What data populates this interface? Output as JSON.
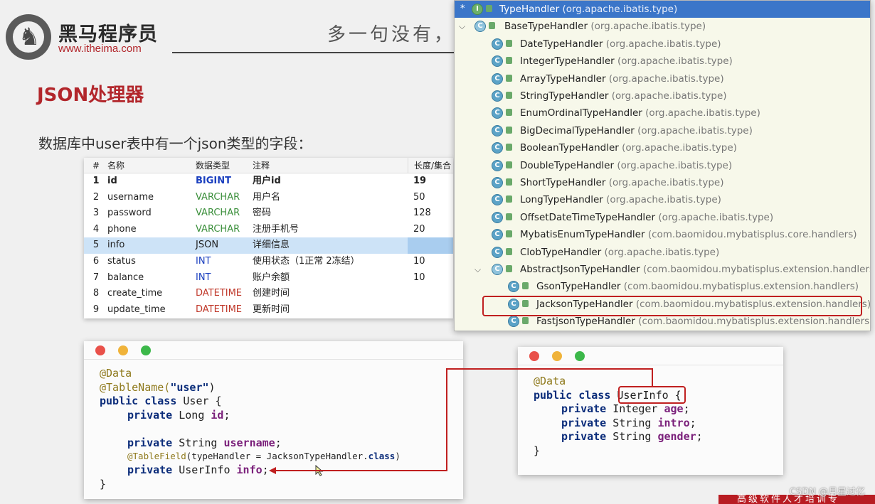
{
  "brand": {
    "name": "黑马程序员",
    "url": "www.itheima.com",
    "slogan": "多一句没有，少"
  },
  "slide": {
    "title": "JSON处理器",
    "subtitle": "数据库中user表中有一个json类型的字段："
  },
  "db_table": {
    "headers": [
      "#",
      "名称",
      "数据类型",
      "注释",
      "长度/集合"
    ],
    "rows": [
      {
        "num": "1",
        "name": "id",
        "type": "BIGINT",
        "note": "用户id",
        "len": "19"
      },
      {
        "num": "2",
        "name": "username",
        "type": "VARCHAR",
        "note": "用户名",
        "len": "50"
      },
      {
        "num": "3",
        "name": "password",
        "type": "VARCHAR",
        "note": "密码",
        "len": "128"
      },
      {
        "num": "4",
        "name": "phone",
        "type": "VARCHAR",
        "note": "注册手机号",
        "len": "20"
      },
      {
        "num": "5",
        "name": "info",
        "type": "JSON",
        "note": "详细信息",
        "len": ""
      },
      {
        "num": "6",
        "name": "status",
        "type": "INT",
        "note": "使用状态（1正常 2冻结）",
        "len": "10"
      },
      {
        "num": "7",
        "name": "balance",
        "type": "INT",
        "note": "账户余额",
        "len": "10"
      },
      {
        "num": "8",
        "name": "create_time",
        "type": "DATETIME",
        "note": "创建时间",
        "len": ""
      },
      {
        "num": "9",
        "name": "update_time",
        "type": "DATETIME",
        "note": "更新时间",
        "len": ""
      }
    ]
  },
  "code_user": {
    "l1": "@Data",
    "l2a": "@TableName(",
    "l2b": "\"user\"",
    "l2c": ")",
    "l3a": "public class ",
    "l3b": "User {",
    "l4a": "private ",
    "l4b": "Long ",
    "l4c": "id",
    "l4d": ";",
    "l5a": "private ",
    "l5b": "String ",
    "l5c": "username",
    "l5d": ";",
    "l6a": "@TableField",
    "l6b": "(typeHandler = JacksonTypeHandler.",
    "l6c": "class",
    "l6d": ")",
    "l7a": "private ",
    "l7b": "UserInfo ",
    "l7c": "info",
    "l7d": ";",
    "l8": "}"
  },
  "code_userinfo": {
    "l1": "@Data",
    "l2a": "public class ",
    "l2b": "UserInfo",
    "l2c": " {",
    "l3a": "private ",
    "l3b": "Integer ",
    "l3c": "age",
    "l3d": ";",
    "l4a": "private ",
    "l4b": "String ",
    "l4c": "intro",
    "l4d": ";",
    "l5a": "private ",
    "l5b": "String ",
    "l5c": "gender",
    "l5d": ";",
    "l6": "}"
  },
  "hierarchy": {
    "items": [
      {
        "name": "TypeHandler",
        "pkg": "(org.apache.ibatis.type)"
      },
      {
        "name": "BaseTypeHandler",
        "pkg": "(org.apache.ibatis.type)"
      },
      {
        "name": "DateTypeHandler",
        "pkg": "(org.apache.ibatis.type)"
      },
      {
        "name": "IntegerTypeHandler",
        "pkg": "(org.apache.ibatis.type)"
      },
      {
        "name": "ArrayTypeHandler",
        "pkg": "(org.apache.ibatis.type)"
      },
      {
        "name": "StringTypeHandler",
        "pkg": "(org.apache.ibatis.type)"
      },
      {
        "name": "EnumOrdinalTypeHandler",
        "pkg": "(org.apache.ibatis.type)"
      },
      {
        "name": "BigDecimalTypeHandler",
        "pkg": "(org.apache.ibatis.type)"
      },
      {
        "name": "BooleanTypeHandler",
        "pkg": "(org.apache.ibatis.type)"
      },
      {
        "name": "DoubleTypeHandler",
        "pkg": "(org.apache.ibatis.type)"
      },
      {
        "name": "ShortTypeHandler",
        "pkg": "(org.apache.ibatis.type)"
      },
      {
        "name": "LongTypeHandler",
        "pkg": "(org.apache.ibatis.type)"
      },
      {
        "name": "OffsetDateTimeTypeHandler",
        "pkg": "(org.apache.ibatis.type)"
      },
      {
        "name": "MybatisEnumTypeHandler",
        "pkg": "(com.baomidou.mybatisplus.core.handlers)"
      },
      {
        "name": "ClobTypeHandler",
        "pkg": "(org.apache.ibatis.type)"
      },
      {
        "name": "AbstractJsonTypeHandler",
        "pkg": "(com.baomidou.mybatisplus.extension.handlers)"
      },
      {
        "name": "GsonTypeHandler",
        "pkg": "(com.baomidou.mybatisplus.extension.handlers)"
      },
      {
        "name": "JacksonTypeHandler",
        "pkg": "(com.baomidou.mybatisplus.extension.handlers)"
      },
      {
        "name": "FastjsonTypeHandler",
        "pkg": "(com.baomidou.mybatisplus.extension.handlers)"
      }
    ]
  },
  "watermark": "CSDN @月星过亿",
  "footer_text": "高级软件人才培训专"
}
